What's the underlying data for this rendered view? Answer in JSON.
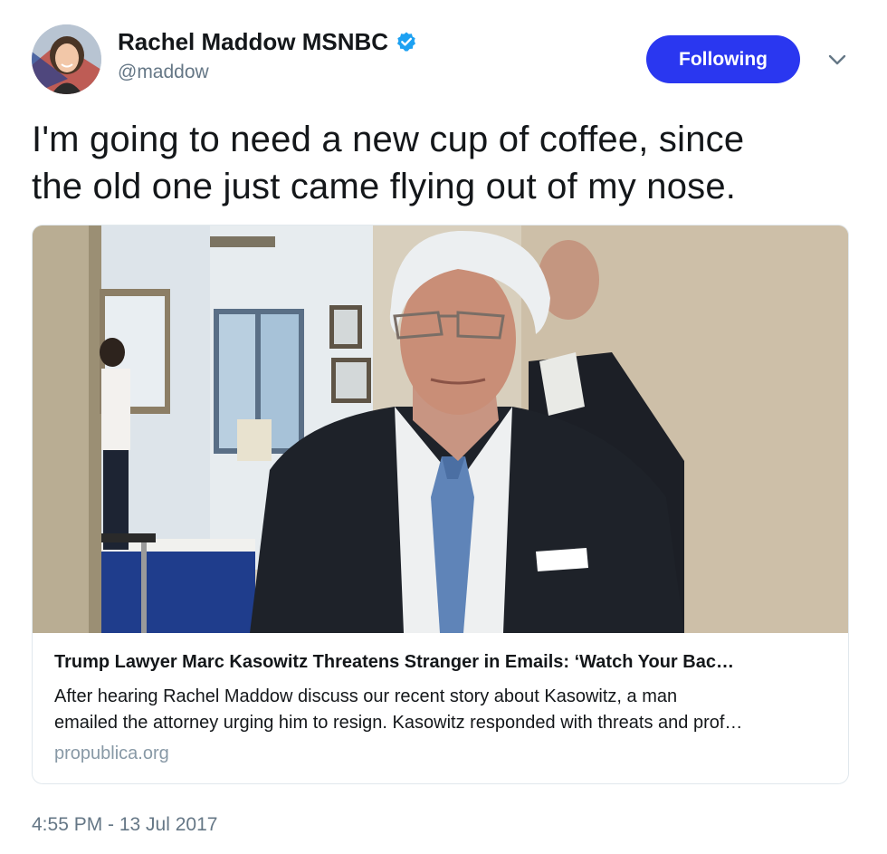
{
  "author": {
    "display_name": "Rachel Maddow MSNBC",
    "handle": "@maddow",
    "verified": true,
    "avatar_icon": "profile-photo"
  },
  "follow_button": {
    "label": "Following",
    "color": "#2a37f0"
  },
  "menu_icon": "chevron-down-icon",
  "tweet": {
    "text_line1": "I'm going to need a new cup of coffee, since",
    "text_line2": "the old one just came flying out of my nose."
  },
  "card": {
    "title": "Trump Lawyer Marc Kasowitz Threatens Stranger in Emails: ‘Watch Your Bac…",
    "description_line1": "After hearing Rachel Maddow discuss our recent story about Kasowitz, a man",
    "description_line2": "emailed the attorney urging him to resign. Kasowitz responded with threats and prof…",
    "domain": "propublica.org"
  },
  "timestamp": "4:55 PM - 13 Jul 2017",
  "colors": {
    "verified_badge": "#1da1f2",
    "secondary_text": "#657786",
    "domain_text": "#8899a6"
  }
}
